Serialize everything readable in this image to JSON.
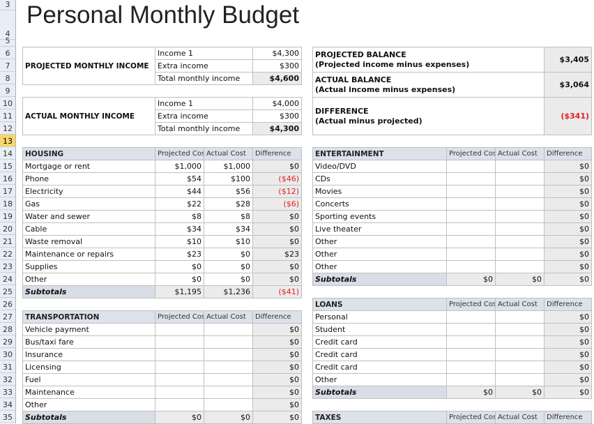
{
  "title": "Personal Monthly Budget",
  "selected_row": 13,
  "colors": {
    "negative": "#e0201f",
    "header_bg": "#dce1ea",
    "selected_row": "#f9d66b"
  },
  "projected_income": {
    "label": "PROJECTED MONTHLY INCOME",
    "rows": [
      [
        "Income 1",
        "$4,300"
      ],
      [
        "Extra income",
        "$300"
      ],
      [
        "Total monthly income",
        "$4,600"
      ]
    ]
  },
  "actual_income": {
    "label": "ACTUAL MONTHLY INCOME",
    "rows": [
      [
        "Income 1",
        "$4,000"
      ],
      [
        "Extra income",
        "$300"
      ],
      [
        "Total monthly income",
        "$4,300"
      ]
    ]
  },
  "balance": [
    {
      "title": "PROJECTED BALANCE",
      "sub": "(Projected income minus expenses)",
      "value": "$3,405"
    },
    {
      "title": "ACTUAL BALANCE",
      "sub": "(Actual income minus expenses)",
      "value": "$3,064"
    },
    {
      "title": "DIFFERENCE",
      "sub": "(Actual minus projected)",
      "value": "($341)",
      "negative": true
    }
  ],
  "columns": [
    "Projected Cost",
    "Actual Cost",
    "Difference"
  ],
  "subtotals_label": "Subtotals",
  "sections": [
    {
      "id": "housing",
      "title": "HOUSING",
      "rows": [
        [
          "Mortgage or rent",
          "$1,000",
          "$1,000",
          "$0"
        ],
        [
          "Phone",
          "$54",
          "$100",
          "($46)"
        ],
        [
          "Electricity",
          "$44",
          "$56",
          "($12)"
        ],
        [
          "Gas",
          "$22",
          "$28",
          "($6)"
        ],
        [
          "Water and sewer",
          "$8",
          "$8",
          "$0"
        ],
        [
          "Cable",
          "$34",
          "$34",
          "$0"
        ],
        [
          "Waste removal",
          "$10",
          "$10",
          "$0"
        ],
        [
          "Maintenance or repairs",
          "$23",
          "$0",
          "$23"
        ],
        [
          "Supplies",
          "$0",
          "$0",
          "$0"
        ],
        [
          "Other",
          "$0",
          "$0",
          "$0"
        ]
      ],
      "subtotals": [
        "$1,195",
        "$1,236",
        "($41)"
      ]
    },
    {
      "id": "transportation",
      "title": "TRANSPORTATION",
      "rows": [
        [
          "Vehicle payment",
          "",
          "",
          "$0"
        ],
        [
          "Bus/taxi fare",
          "",
          "",
          "$0"
        ],
        [
          "Insurance",
          "",
          "",
          "$0"
        ],
        [
          "Licensing",
          "",
          "",
          "$0"
        ],
        [
          "Fuel",
          "",
          "",
          "$0"
        ],
        [
          "Maintenance",
          "",
          "",
          "$0"
        ],
        [
          "Other",
          "",
          "",
          "$0"
        ]
      ],
      "subtotals": [
        "$0",
        "$0",
        "$0"
      ]
    },
    {
      "id": "entertainment",
      "title": "ENTERTAINMENT",
      "rows": [
        [
          "Video/DVD",
          "",
          "",
          "$0"
        ],
        [
          "CDs",
          "",
          "",
          "$0"
        ],
        [
          "Movies",
          "",
          "",
          "$0"
        ],
        [
          "Concerts",
          "",
          "",
          "$0"
        ],
        [
          "Sporting events",
          "",
          "",
          "$0"
        ],
        [
          "Live theater",
          "",
          "",
          "$0"
        ],
        [
          "Other",
          "",
          "",
          "$0"
        ],
        [
          "Other",
          "",
          "",
          "$0"
        ],
        [
          "Other",
          "",
          "",
          "$0"
        ]
      ],
      "subtotals": [
        "$0",
        "$0",
        "$0"
      ]
    },
    {
      "id": "loans",
      "title": "LOANS",
      "rows": [
        [
          "Personal",
          "",
          "",
          "$0"
        ],
        [
          "Student",
          "",
          "",
          "$0"
        ],
        [
          "Credit card",
          "",
          "",
          "$0"
        ],
        [
          "Credit card",
          "",
          "",
          "$0"
        ],
        [
          "Credit card",
          "",
          "",
          "$0"
        ],
        [
          "Other",
          "",
          "",
          "$0"
        ]
      ],
      "subtotals": [
        "$0",
        "$0",
        "$0"
      ]
    },
    {
      "id": "taxes",
      "title": "TAXES",
      "rows": [],
      "subtotals": null
    }
  ]
}
